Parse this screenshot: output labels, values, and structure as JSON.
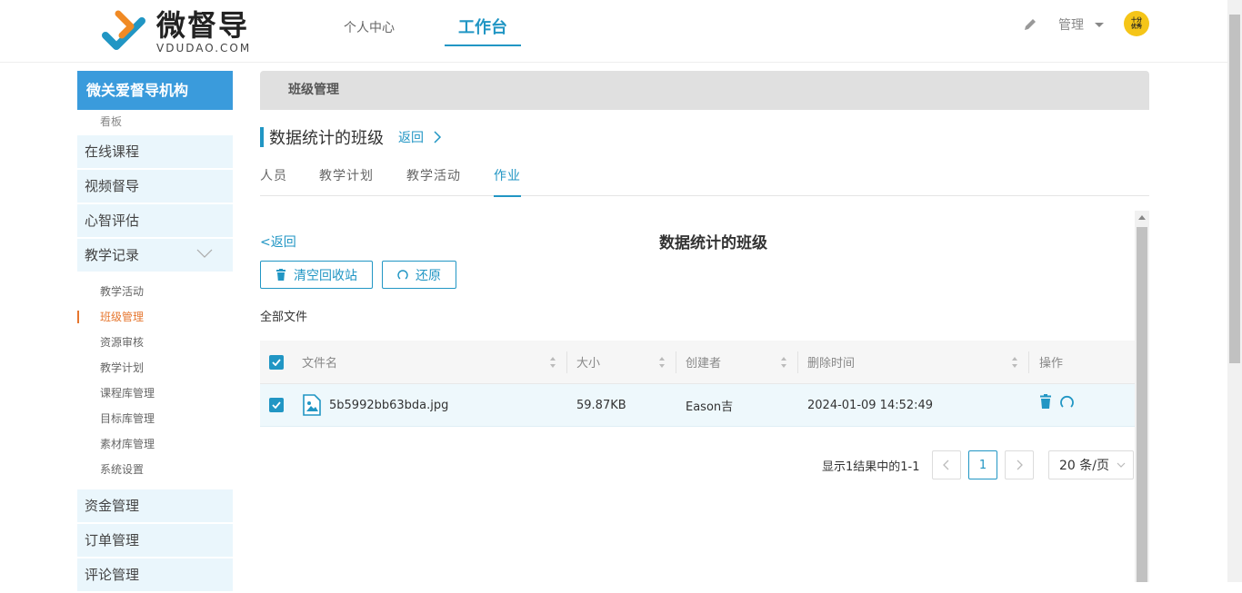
{
  "header": {
    "logo_cn": "微督导",
    "logo_en": "VDUDAO.COM",
    "nav": {
      "personal": "个人中心",
      "workbench": "工作台"
    },
    "admin_label": "管理",
    "avatar_line1": "十分",
    "avatar_line2": "优秀"
  },
  "sidebar": {
    "org_name": "微关爱督导机构",
    "top_sub": "看板",
    "menus": {
      "online_course": "在线课程",
      "video_supervision": "视频督导",
      "mental_eval": "心智评估",
      "teaching_record": "教学记录",
      "funds": "资金管理",
      "orders": "订单管理",
      "comments": "评论管理"
    },
    "teaching_subs": [
      "教学活动",
      "班级管理",
      "资源审核",
      "教学计划",
      "课程库管理",
      "目标库管理",
      "素材库管理",
      "系统设置"
    ],
    "active_sub": "班级管理"
  },
  "breadcrumb": "班级管理",
  "page": {
    "title": "数据统计的班级",
    "back": "返回",
    "tabs": [
      "人员",
      "教学计划",
      "教学活动",
      "作业"
    ],
    "active_tab": "作业"
  },
  "recycle": {
    "back": "返回",
    "title": "数据统计的班级",
    "clear_button": "清空回收站",
    "restore_button": "还原",
    "all_files": "全部文件",
    "columns": {
      "name": "文件名",
      "size": "大小",
      "creator": "创建者",
      "deleted_at": "删除时间",
      "actions": "操作"
    },
    "rows": [
      {
        "name": "5b5992bb63bda.jpg",
        "size": "59.87KB",
        "creator": "Eason吉",
        "deleted_at": "2024-01-09 14:52:49",
        "checked": true
      }
    ],
    "pagination": {
      "info": "显示1结果中的1-1",
      "current_page": "1",
      "page_size": "20 条/页"
    }
  },
  "colors": {
    "accent": "#2196c4",
    "active_sub": "#e6762e",
    "org_bg": "#3a9bdc"
  }
}
